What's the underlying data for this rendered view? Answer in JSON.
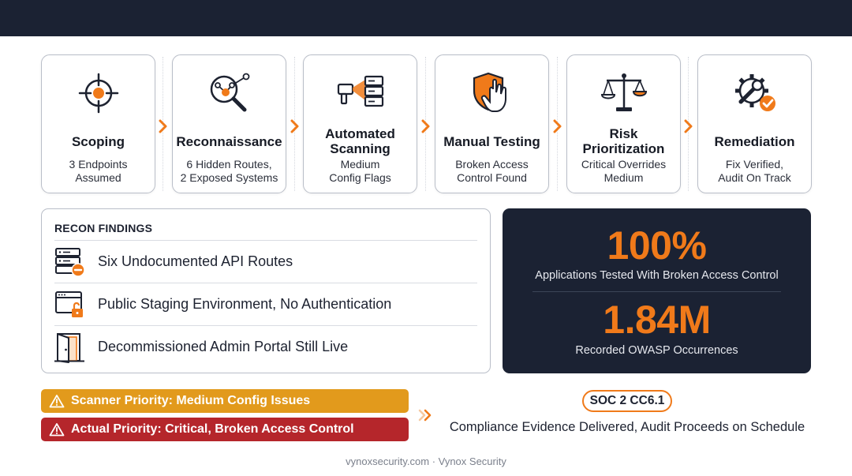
{
  "colors": {
    "accent": "#f07a1a",
    "navy": "#1b2233",
    "medium_bar": "#e29a1c",
    "critical_bar": "#b5262b"
  },
  "pipeline": [
    {
      "icon": "target-icon",
      "title": "Scoping",
      "desc": [
        "3 Endpoints",
        "Assumed"
      ]
    },
    {
      "icon": "magnifier-network-icon",
      "title": "Reconnaissance",
      "desc": [
        "6 Hidden Routes,",
        "2 Exposed Systems"
      ]
    },
    {
      "icon": "scanner-server-icon",
      "title": "Automated Scanning",
      "desc": [
        "Medium",
        "Config Flags"
      ]
    },
    {
      "icon": "shield-hand-icon",
      "title": "Manual Testing",
      "desc": [
        "Broken Access",
        "Control Found"
      ]
    },
    {
      "icon": "scales-icon",
      "title": "Risk Prioritization",
      "desc": [
        "Critical Overrides",
        "Medium"
      ]
    },
    {
      "icon": "gear-wrench-check-icon",
      "title": "Remediation",
      "desc": [
        "Fix Verified,",
        "Audit On Track"
      ]
    }
  ],
  "findings": {
    "heading": "RECON FINDINGS",
    "items": [
      {
        "icon": "server-blocked-icon",
        "text": "Six Undocumented API Routes"
      },
      {
        "icon": "browser-unlocked-icon",
        "text": "Public Staging Environment, No Authentication"
      },
      {
        "icon": "open-door-icon",
        "text": "Decommissioned Admin Portal Still Live"
      }
    ]
  },
  "stats": [
    {
      "value": "100%",
      "caption": "Applications Tested With Broken Access Control"
    },
    {
      "value": "1.84M",
      "caption": "Recorded OWASP Occurrences"
    }
  ],
  "priorities": {
    "scanner": "Scanner Priority: Medium Config Issues",
    "actual": "Actual Priority: Critical, Broken Access Control"
  },
  "compliance": {
    "badge": "SOC 2 CC6.1",
    "text": "Compliance Evidence Delivered, Audit Proceeds on Schedule"
  },
  "footer": "vynoxsecurity.com · Vynox Security"
}
